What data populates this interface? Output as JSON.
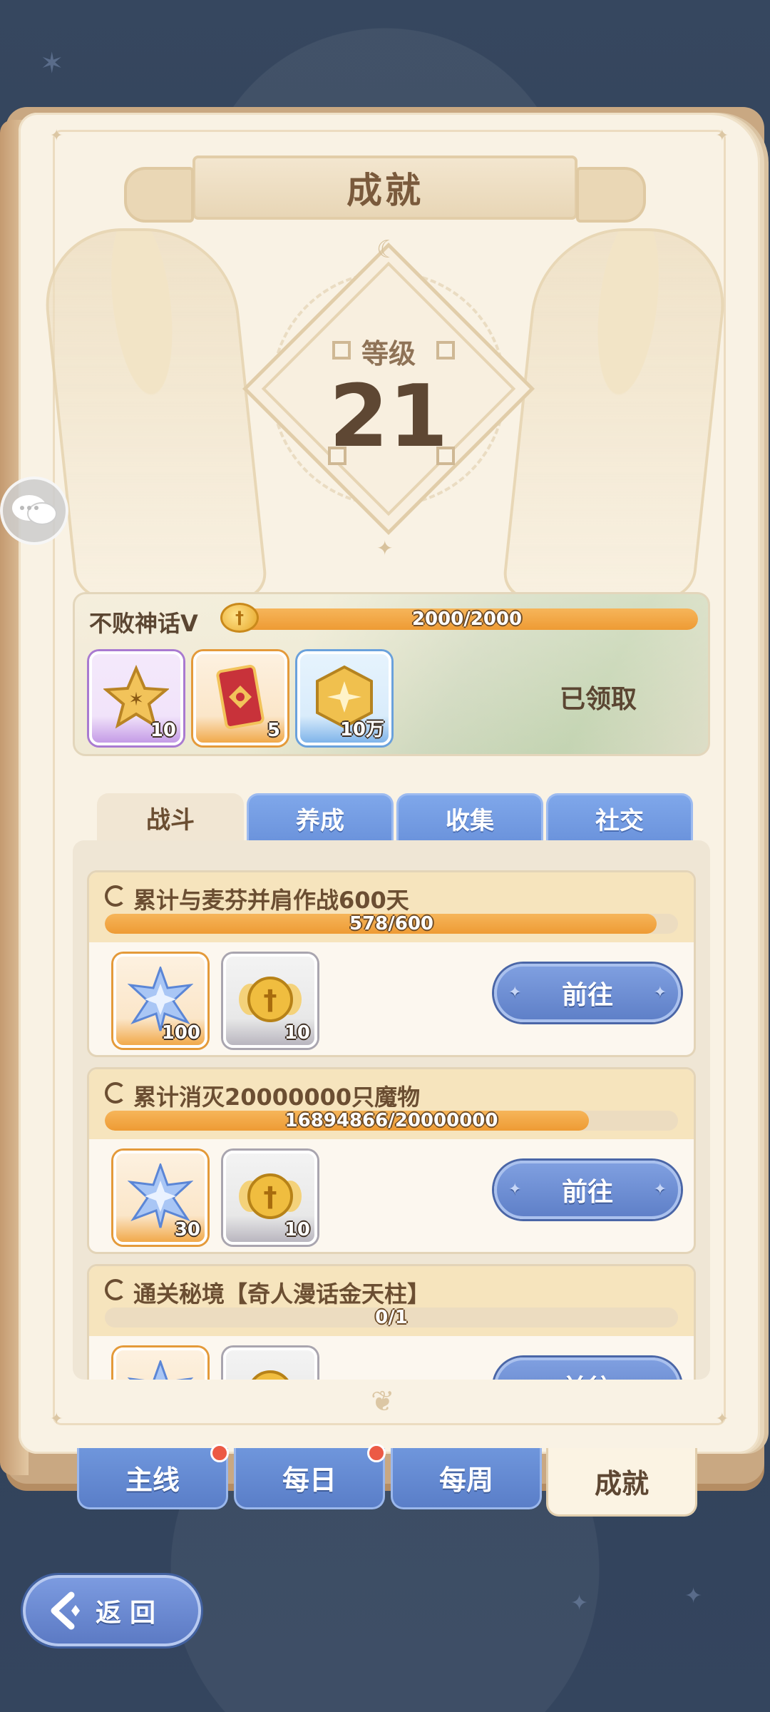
{
  "header": {
    "title": "成就"
  },
  "level": {
    "label": "等级",
    "value": "21"
  },
  "milestone": {
    "name": "不败神话Ⅴ",
    "progress_text": "2000/2000",
    "progress": 1.0,
    "status": "已领取",
    "rewards": [
      {
        "icon": "star-badge-icon",
        "qty": "10",
        "rarity": "purple"
      },
      {
        "icon": "eye-card-icon",
        "qty": "5",
        "rarity": "orange"
      },
      {
        "icon": "hex-coin-icon",
        "qty": "10万",
        "rarity": "blue"
      }
    ]
  },
  "category_tabs": [
    {
      "label": "战斗",
      "active": true
    },
    {
      "label": "养成",
      "active": false
    },
    {
      "label": "收集",
      "active": false
    },
    {
      "label": "社交",
      "active": false
    }
  ],
  "tasks": [
    {
      "title": "累计与麦芬并肩作战600天",
      "progress_text": "578/600",
      "progress": 0.963,
      "rewards": [
        {
          "icon": "blue-star-crystal-icon",
          "qty": "100",
          "rarity": "orange"
        },
        {
          "icon": "winged-coin-icon",
          "qty": "10",
          "rarity": "gray"
        }
      ],
      "action": "前往"
    },
    {
      "title": "累计消灭20000000只魔物",
      "progress_text": "16894866/20000000",
      "progress": 0.845,
      "rewards": [
        {
          "icon": "blue-star-crystal-icon",
          "qty": "30",
          "rarity": "orange"
        },
        {
          "icon": "winged-coin-icon",
          "qty": "10",
          "rarity": "gray"
        }
      ],
      "action": "前往"
    },
    {
      "title": "通关秘境【奇人漫话金天柱】",
      "progress_text": "0/1",
      "progress": 0,
      "rewards": [
        {
          "icon": "blue-star-crystal-icon",
          "qty": "",
          "rarity": "orange"
        },
        {
          "icon": "winged-coin-icon",
          "qty": "",
          "rarity": "gray"
        }
      ],
      "action": "前往"
    }
  ],
  "page_tabs": [
    {
      "label": "主线",
      "badge": true,
      "active": false
    },
    {
      "label": "每日",
      "badge": true,
      "active": false
    },
    {
      "label": "每周",
      "badge": false,
      "active": false
    },
    {
      "label": "成就",
      "badge": false,
      "active": true
    }
  ],
  "back_button": {
    "label": "返回"
  },
  "colors": {
    "accent_orange": "#ee9b34",
    "tab_blue": "#6b93dc",
    "badge_red": "#ec5a45",
    "text_brown": "#6b4e32"
  }
}
